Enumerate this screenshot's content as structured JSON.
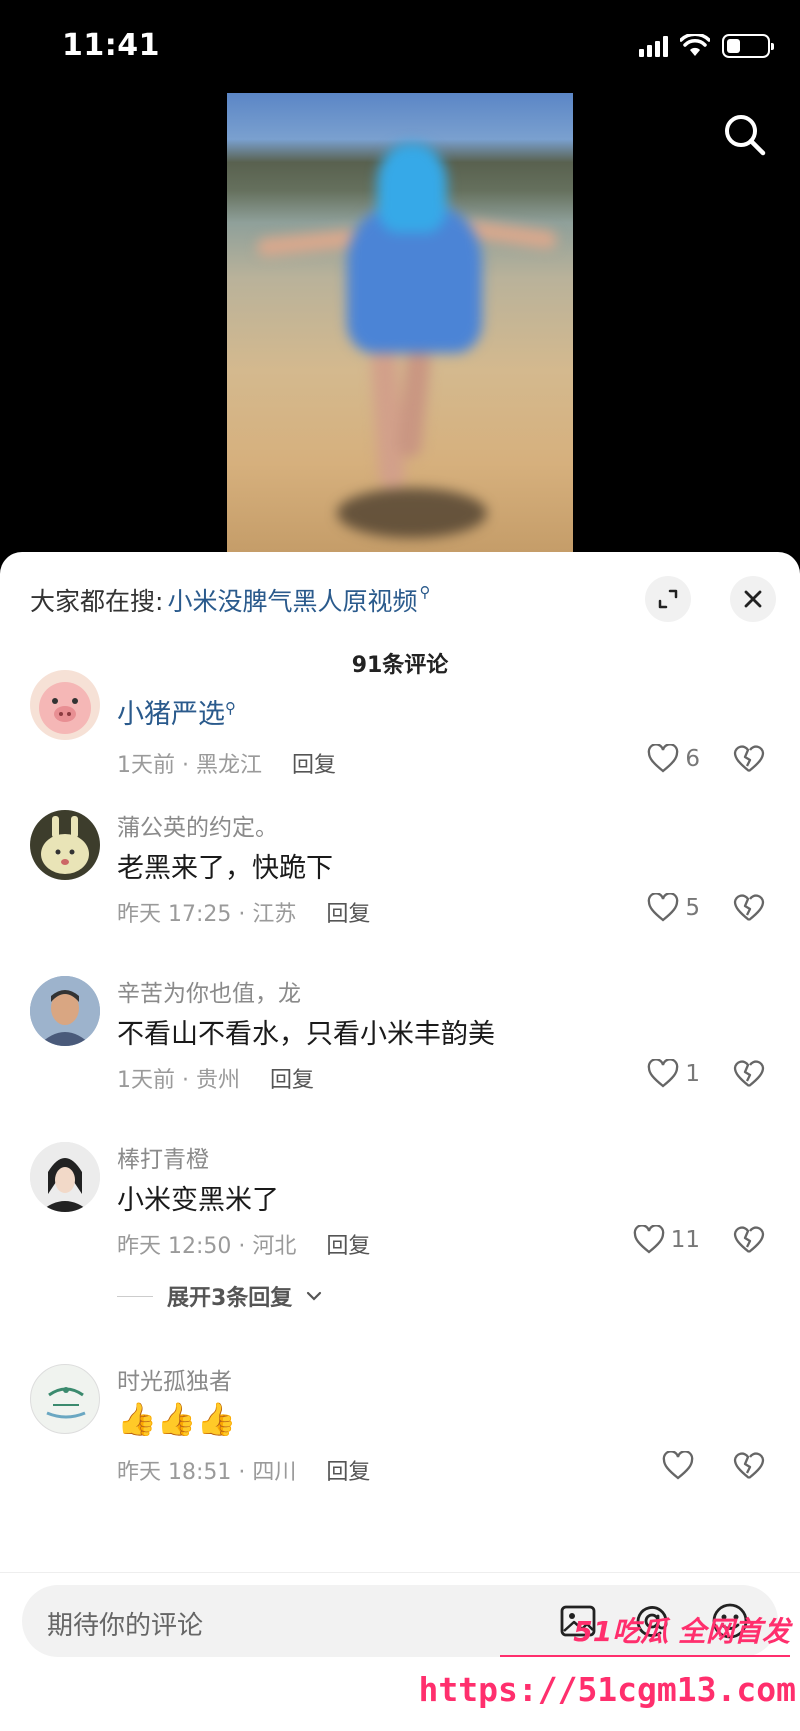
{
  "status_bar": {
    "time": "11:41",
    "battery_level": 0.35
  },
  "video": {
    "description_icon": "video-frame"
  },
  "panel": {
    "hot_search_prefix": "大家都在搜:",
    "hot_search_term": "小米没脾气黑人原视频",
    "comment_count": "91条评论"
  },
  "comments": [
    {
      "user": "小猪严选",
      "text": "",
      "time": "1天前 · 黑龙江",
      "reply": "回复",
      "likes": "6"
    },
    {
      "user": "蒲公英的约定。",
      "text": "老黑来了，快跪下",
      "time": "昨天 17:25 · 江苏",
      "reply": "回复",
      "likes": "5"
    },
    {
      "user": "辛苦为你也值，龙",
      "text": "不看山不看水，只看小米丰韵美",
      "time": "1天前 · 贵州",
      "reply": "回复",
      "likes": "1"
    },
    {
      "user": "棒打青橙",
      "text": "小米变黑米了",
      "time": "昨天 12:50 · 河北",
      "reply": "回复",
      "likes": "11",
      "expand": "展开3条回复"
    },
    {
      "user": "时光孤独者",
      "text": "👍👍👍",
      "time": "昨天 18:51 · 四川",
      "reply": "回复",
      "likes": ""
    }
  ],
  "input": {
    "placeholder": "期待你的评论"
  },
  "watermark": {
    "brand": "51吃瓜 全网首发",
    "url": "https://51cgm13.com"
  },
  "colors": {
    "link": "#2a5a8c",
    "watermark": "#ff2f6d"
  }
}
